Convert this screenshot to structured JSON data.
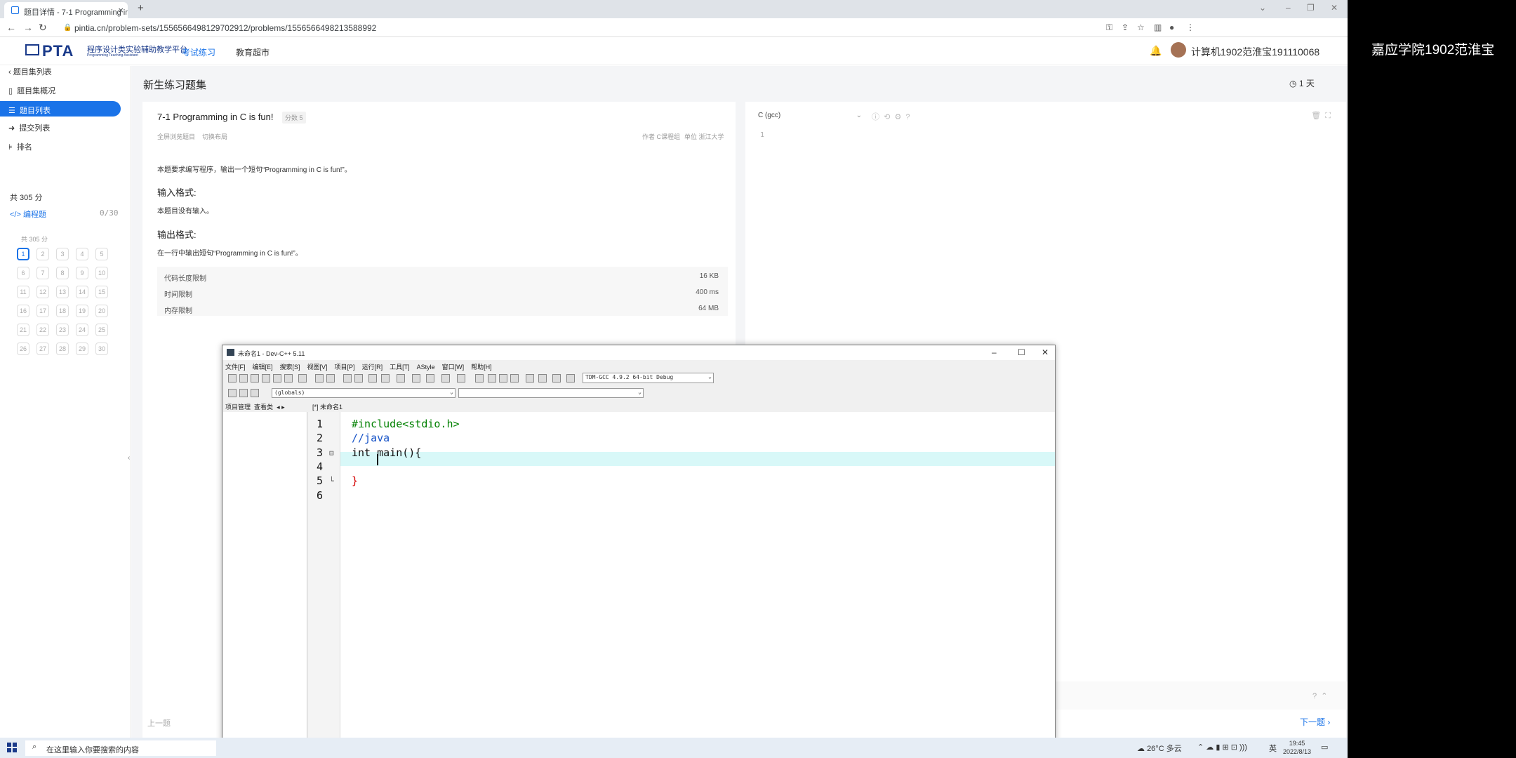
{
  "side_caption": "嘉应学院1902范淮宝",
  "browser": {
    "tab_title": "题目详情 - 7-1 Programming in",
    "url": "pintia.cn/problem-sets/1556566498129702912/problems/1556566498213588992"
  },
  "header": {
    "logo": "PTA",
    "logo_sub": "程序设计类实验辅助教学平台",
    "logo_sub2": "Programming Teaching Assistant",
    "nav": [
      "考试练习",
      "教育超市"
    ],
    "user": "计算机1902范淮宝191110068"
  },
  "sidebar": {
    "back": "题目集列表",
    "items": [
      "题目集概况",
      "题目列表",
      "提交列表",
      "排名"
    ],
    "total": "共 305 分",
    "program": "编程题",
    "count": "0/30",
    "score_small": "共 305 分",
    "numbers": [
      "1",
      "2",
      "3",
      "4",
      "5",
      "6",
      "7",
      "8",
      "9",
      "10",
      "11",
      "12",
      "13",
      "14",
      "15",
      "16",
      "17",
      "18",
      "19",
      "20",
      "21",
      "22",
      "23",
      "24",
      "25",
      "26",
      "27",
      "28",
      "29",
      "30"
    ]
  },
  "main": {
    "set_title": "新生练习题集",
    "days": "1 天",
    "problem": {
      "title": "7-1 Programming in C is fun!",
      "score": "分数 5",
      "link_fullscreen": "全屏浏览题目",
      "link_layout": "切换布局",
      "author": "作者 C课程组",
      "unit": "单位 浙江大学",
      "desc": "本题要求编写程序，输出一个短句“Programming in C is fun!”。",
      "input_head": "输入格式:",
      "input_text": "本题目没有输入。",
      "output_head": "输出格式:",
      "output_text": "在一行中输出短句“Programming in C is fun!”。",
      "limits": [
        {
          "label": "代码长度限制",
          "value": "16 KB"
        },
        {
          "label": "时间限制",
          "value": "400 ms"
        },
        {
          "label": "内存限制",
          "value": "64 MB"
        }
      ]
    },
    "editor": {
      "lang": "C (gcc)",
      "line": "1"
    },
    "prev": "上一题",
    "next": "下一题"
  },
  "devcpp": {
    "title": "未命名1 - Dev-C++ 5.11",
    "menus": [
      "文件[F]",
      "编辑[E]",
      "搜索[S]",
      "视图[V]",
      "项目[P]",
      "运行[R]",
      "工具[T]",
      "AStyle",
      "窗口[W]",
      "帮助[H]"
    ],
    "compiler": "TDM-GCC 4.9.2 64-bit Debug",
    "scope": "(globals)",
    "panel_tabs": [
      "项目管理",
      "查看类"
    ],
    "file_tab": "[*] 未命名1",
    "code": [
      {
        "n": "1",
        "text": "#include<stdio.h>",
        "color": "#008000"
      },
      {
        "n": "2",
        "text": "//java",
        "color": "#1a56c8"
      },
      {
        "n": "3",
        "text": "int main(){",
        "color": "#111111"
      },
      {
        "n": "4",
        "text": "    ",
        "color": "#111111"
      },
      {
        "n": "5",
        "text": "}",
        "color": "#d40000"
      },
      {
        "n": "6",
        "text": "",
        "color": "#111111"
      }
    ]
  },
  "taskbar": {
    "search": "在这里输入你要搜索的内容",
    "weather": "26°C 多云",
    "lang": "英",
    "time": "19:45",
    "date": "2022/8/13"
  }
}
